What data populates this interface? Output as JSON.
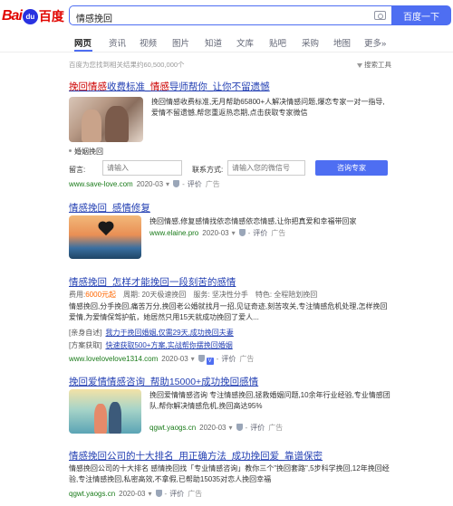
{
  "header": {
    "logo_left": "Bai",
    "logo_paw": "du",
    "logo_right": "百度",
    "query": "情感挽回",
    "search_button": "百度一下"
  },
  "tabs": [
    "网页",
    "资讯",
    "视频",
    "图片",
    "知道",
    "文库",
    "贴吧",
    "采购",
    "地图",
    "更多»"
  ],
  "meta": {
    "result_count": "百度为您找到相关结果约60,500,000个",
    "tools": "搜索工具"
  },
  "results": [
    {
      "title_parts": [
        "挽回情感",
        "收费标准_",
        "情感",
        "导师帮你_让你不留遗憾"
      ],
      "desc": "挽回情感收费标准,无月帮助65800+人解决情感问题,爆恋专家一对一指导,爱情不留遗憾,帮您重返热恋期,点击获取专家微信",
      "sub_title": "婚姻挽回",
      "form": {
        "label1": "留言:",
        "placeholder1": "请输入",
        "label2": "联系方式:",
        "placeholder2": "请输入您的微信号",
        "button": "咨询专家"
      },
      "source": "www.save-love.com",
      "date": "2020-03",
      "review": "评价",
      "ad": "广告"
    },
    {
      "title": "情感挽回_感情修复",
      "desc": "挽回情感,修复感情找依恋情感依恋情感,让你把真爱和幸福带回家",
      "source": "www.elaine.pro",
      "date": "2020-03",
      "review": "评价",
      "ad": "广告"
    },
    {
      "title": "情感挽回_怎样才能挽回一段刻苦的感情",
      "kv": {
        "fee_label": "费用:",
        "fee_value": "6000元起",
        "period": "周期: 20天极速挽回",
        "service": "服务: 坚决性分手",
        "feature": "特色: 全程陪划挽回"
      },
      "desc": "情感挽回,分手挽回,痛苦万分,挽回老公婚就找月一招,见证奇迹,刻苦攻关,专注情感危机处理,怎样挽回爱情,为爱情保驾护航，她居然只用15天就成功挽回了爱人...",
      "line1_label": "[亲身自述]",
      "line1_link": "我力于挽回婚姻,仅需29天,成功挽回夫妻",
      "line2_label": "[方案获取]",
      "line2_link": "快速获取500+方案,实战帮你摆挽回婚姻",
      "source": "www.lovelovelove1314.com",
      "date": "2020-03",
      "review": "评价",
      "ad": "广告"
    },
    {
      "title": "挽回爱情情感咨询_帮助15000+成功挽回感情",
      "desc": "挽回爱情情感咨询 专注情感挽回,拯救婚姻问题,10余年行业经验,专业情感团队,帮你解决情感危机,挽回高达95%",
      "source": "qgwt.yaogs.cn",
      "date": "2020-03",
      "review": "评价",
      "ad": "广告"
    },
    {
      "title": "情感挽回公司的十大排名_用正确方法_成功挽回爱_靠谱保密",
      "desc": "情感挽回公司的十大排名 感情挽回找「专业情感咨询」教你三个\"挽回套路\",5步科学挽回,12年挽回经验,专注情感挽回,私密高效,不拿假,已帮助15035对恋人挽回幸福",
      "source": "qgwt.yaogs.cn",
      "date": "2020-03",
      "review": "评价",
      "ad": "广告"
    }
  ]
}
